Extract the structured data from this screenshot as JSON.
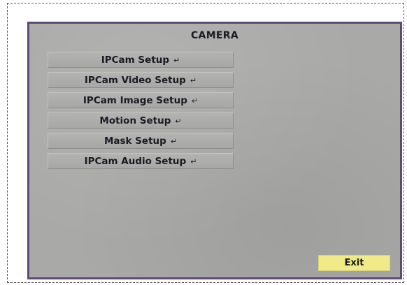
{
  "screen": {
    "title": "CAMERA"
  },
  "menu": {
    "items": [
      {
        "label": "IPCam Setup",
        "icon": "enter-icon"
      },
      {
        "label": "IPCam Video Setup",
        "icon": "enter-icon"
      },
      {
        "label": "IPCam Image Setup",
        "icon": "enter-icon"
      },
      {
        "label": "Motion Setup",
        "icon": "enter-icon"
      },
      {
        "label": "Mask Setup",
        "icon": "enter-icon"
      },
      {
        "label": "IPCam Audio Setup",
        "icon": "enter-icon"
      }
    ],
    "enter_glyph": "↵"
  },
  "footer": {
    "exit_label": "Exit"
  },
  "colors": {
    "panel_bg": "#a9aaa7",
    "panel_border": "#5e4a72",
    "exit_bg": "#f0ea88",
    "text": "#1a1a24"
  }
}
